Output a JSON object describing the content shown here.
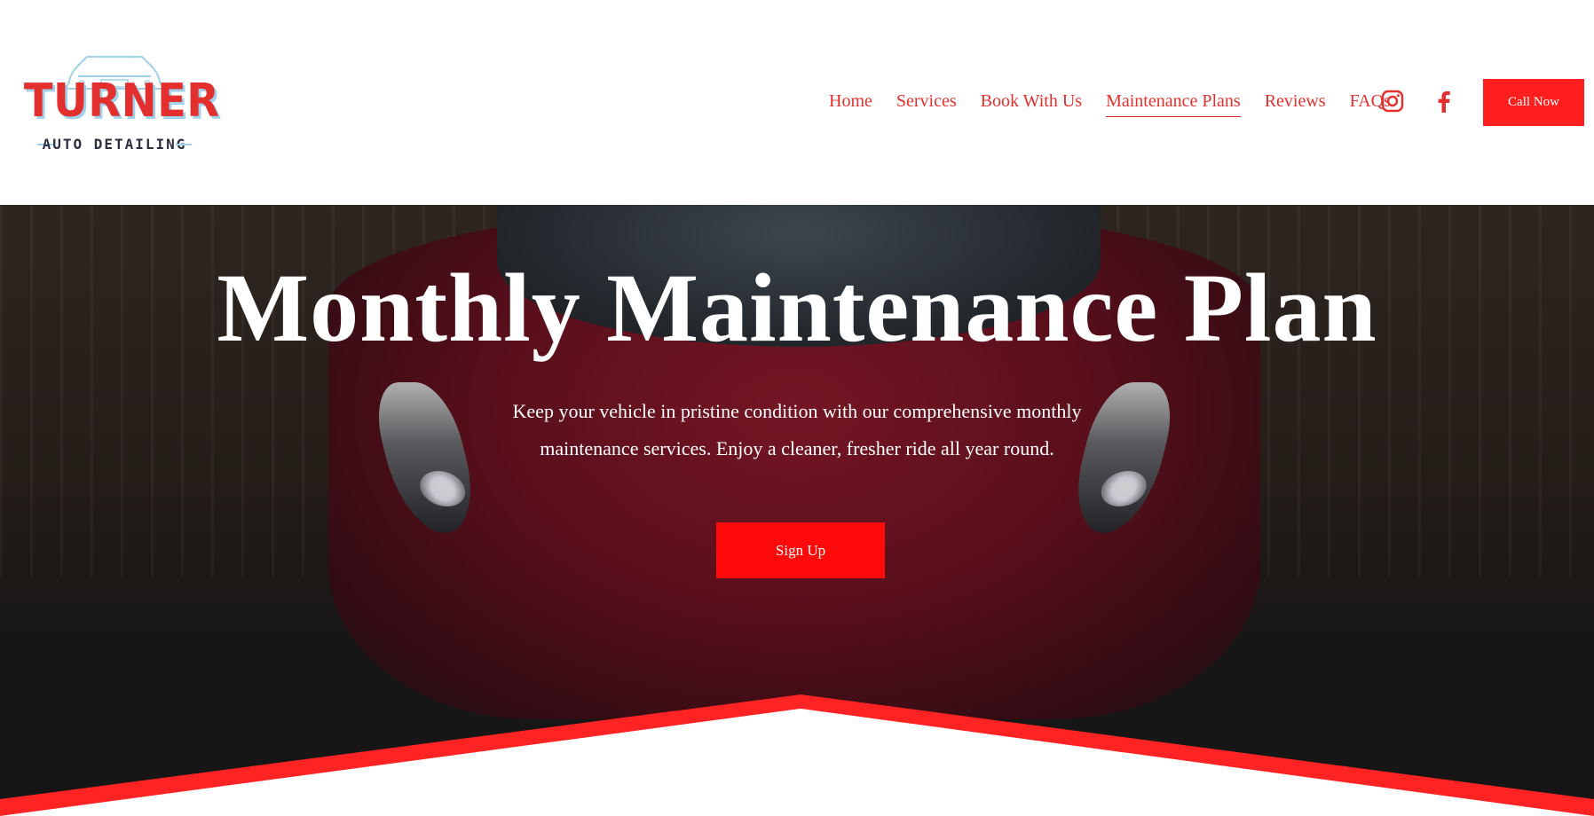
{
  "brand": {
    "name": "TURNER",
    "tagline": "AUTO DETAILING",
    "logo_icon": "car-outline-icon"
  },
  "nav": {
    "items": [
      {
        "label": "Home",
        "active": false
      },
      {
        "label": "Services",
        "active": false
      },
      {
        "label": "Book With Us",
        "active": false
      },
      {
        "label": "Maintenance Plans",
        "active": true
      },
      {
        "label": "Reviews",
        "active": false
      },
      {
        "label": "FAQs",
        "active": false
      }
    ],
    "social": [
      "instagram-icon",
      "facebook-icon"
    ],
    "cta_label": "Call Now"
  },
  "hero": {
    "title": "Monthly Maintenance Plan",
    "description": "Keep your vehicle in pristine condition with our comprehensive monthly maintenance services.  Enjoy a cleaner, fresher ride all year round.",
    "button_label": "Sign Up"
  },
  "colors": {
    "accent": "#e3302e",
    "button_red": "#ff0a0a",
    "logo_blue": "#9fd2ea",
    "logo_dark": "#2b2e3f"
  }
}
